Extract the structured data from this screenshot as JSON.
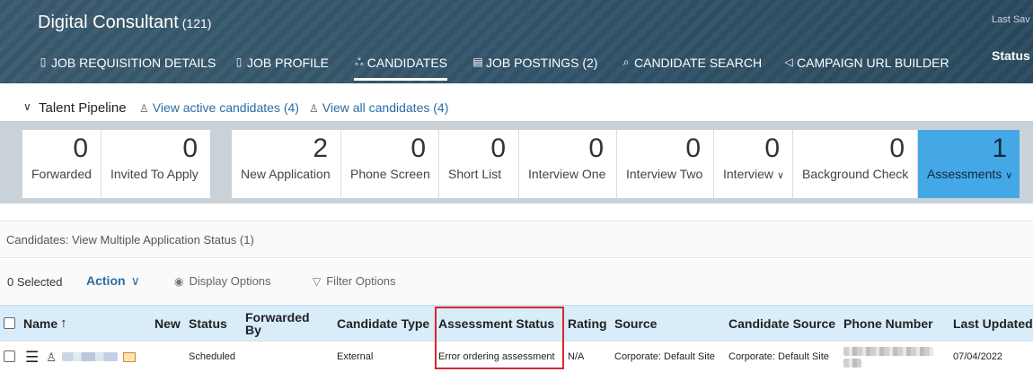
{
  "header": {
    "job_title": "Digital Consultant",
    "job_count": "(121)",
    "last_saved": "Last Sav",
    "status_label": "Status",
    "tabs": [
      {
        "label": "JOB REQUISITION DETAILS",
        "icon": "document-icon"
      },
      {
        "label": "JOB PROFILE",
        "icon": "document-icon"
      },
      {
        "label": "CANDIDATES",
        "icon": "people-icon"
      },
      {
        "label": "JOB POSTINGS (2)",
        "icon": "clipboard-icon"
      },
      {
        "label": "CANDIDATE SEARCH",
        "icon": "search-icon"
      },
      {
        "label": "CAMPAIGN URL BUILDER",
        "icon": "megaphone-icon"
      }
    ]
  },
  "pipeline": {
    "title": "Talent Pipeline",
    "view_active": "View active candidates (4)",
    "view_all": "View all candidates (4)",
    "stages_left": [
      {
        "count": "0",
        "label": "Forwarded"
      },
      {
        "count": "0",
        "label": "Invited To Apply"
      }
    ],
    "stages_right": [
      {
        "count": "2",
        "label": "New Application"
      },
      {
        "count": "0",
        "label": "Phone Screen"
      },
      {
        "count": "0",
        "label": "Short List"
      },
      {
        "count": "0",
        "label": "Interview One"
      },
      {
        "count": "0",
        "label": "Interview Two"
      },
      {
        "count": "0",
        "label": "Interview"
      },
      {
        "count": "0",
        "label": "Background Check"
      },
      {
        "count": "1",
        "label": "Assessments"
      }
    ]
  },
  "candidates_title": "Candidates: View Multiple Application Status (1)",
  "toolbar": {
    "selected": "0 Selected",
    "action": "Action",
    "display_options": "Display Options",
    "filter_options": "Filter Options"
  },
  "table": {
    "columns": {
      "name": "Name",
      "new": "New",
      "status": "Status",
      "forwarded_by": "Forwarded By",
      "candidate_type": "Candidate Type",
      "assessment_status": "Assessment Status",
      "rating": "Rating",
      "source": "Source",
      "candidate_source": "Candidate Source",
      "phone_number": "Phone Number",
      "last_updated": "Last Updated"
    },
    "rows": [
      {
        "status": "Scheduled",
        "candidate_type": "External",
        "assessment_status": "Error ordering assessment",
        "rating": "N/A",
        "source": "Corporate: Default Site",
        "candidate_source": "Corporate: Default Site",
        "last_updated": "07/04/2022"
      }
    ]
  },
  "colors": {
    "header_bg": "#33556a",
    "active_stage": "#44a8e6",
    "link": "#2b6ca3",
    "table_header": "#d8ecfa",
    "highlight_border": "#d9262c"
  }
}
